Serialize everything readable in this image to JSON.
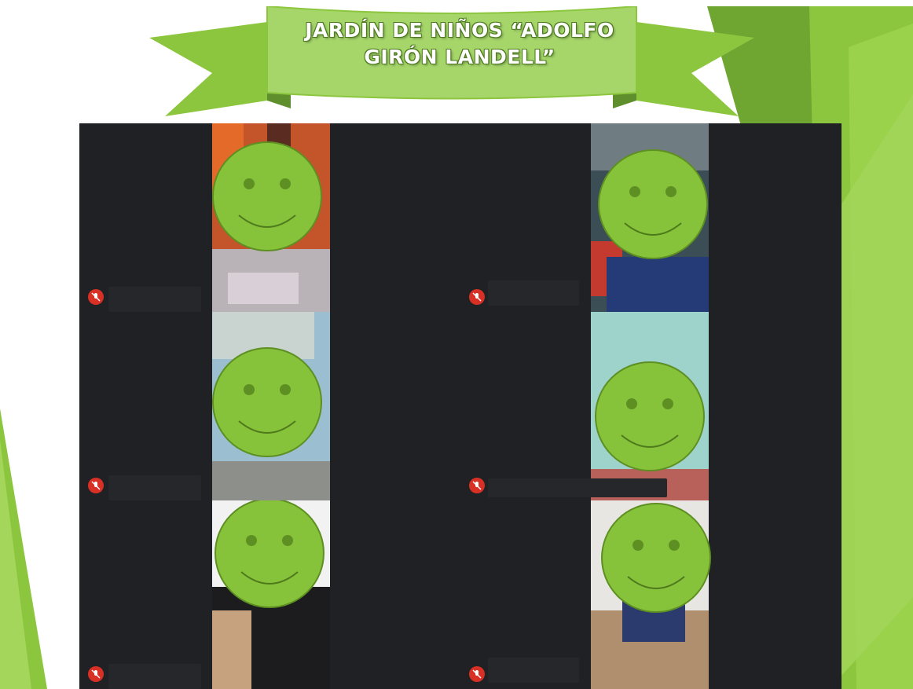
{
  "slide": {
    "title_line1": "JARDÍN DE NIÑOS “ADOLFO",
    "title_line2": "GIRÓN LANDELL”",
    "colors": {
      "green_light": "#8cc63e",
      "green_mid": "#79ad34",
      "green_dark": "#5f8f2c",
      "ribbon_fill": "#a6d66a",
      "face_fill": "#86c23a",
      "face_stroke": "#5e8f22",
      "tile_bg": "#202124",
      "mute_red": "#d93025"
    }
  },
  "meeting": {
    "participants": [
      {
        "position": "row1-left",
        "muted": true,
        "icon": "mic-off-icon",
        "face": "smiley-face-icon"
      },
      {
        "position": "row1-right",
        "muted": true,
        "icon": "mic-off-icon",
        "face": "smiley-face-icon"
      },
      {
        "position": "row2-left",
        "muted": true,
        "icon": "mic-off-icon",
        "face": "smiley-face-icon"
      },
      {
        "position": "row2-right",
        "muted": true,
        "icon": "mic-off-icon",
        "face": "smiley-face-icon"
      },
      {
        "position": "row3-left",
        "muted": true,
        "icon": "mic-off-icon",
        "face": "smiley-face-icon"
      },
      {
        "position": "row3-right",
        "muted": true,
        "icon": "mic-off-icon",
        "face": "smiley-face-icon"
      }
    ]
  }
}
